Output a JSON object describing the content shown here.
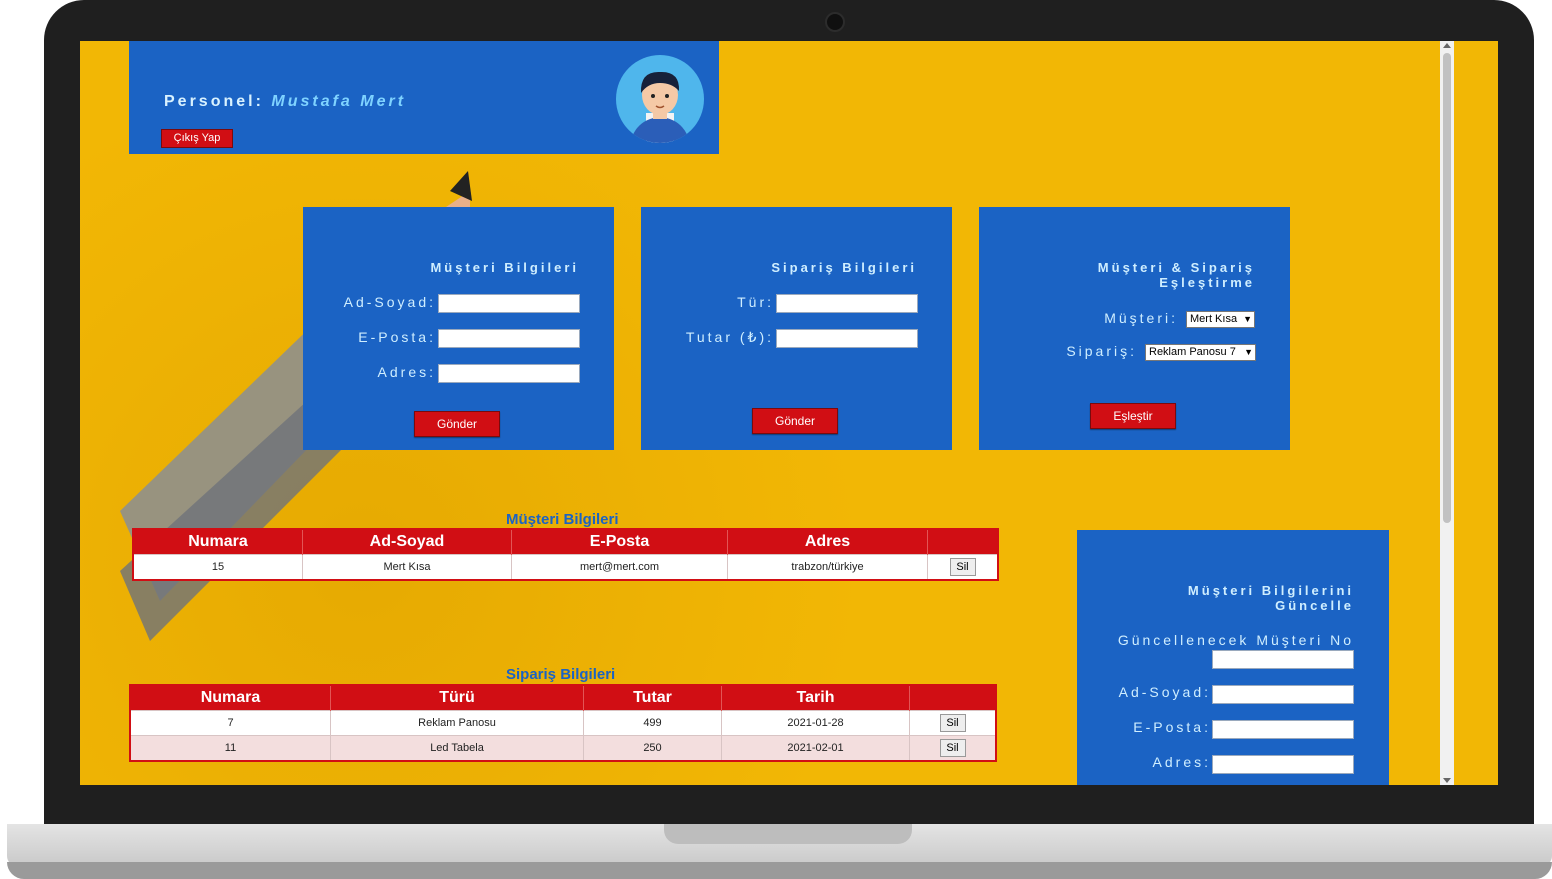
{
  "header": {
    "personel_label": "Personel:",
    "personel_name": "Mustafa Mert",
    "logout_label": "Çıkış Yap"
  },
  "customer_form": {
    "title": "Müşteri Bilgileri",
    "name_label": "Ad-Soyad:",
    "email_label": "E-Posta:",
    "address_label": "Adres:",
    "name_value": "",
    "email_value": "",
    "address_value": "",
    "submit_label": "Gönder"
  },
  "order_form": {
    "title": "Sipariş Bilgileri",
    "type_label": "Tür:",
    "amount_label": "Tutar (₺):",
    "type_value": "",
    "amount_value": "",
    "submit_label": "Gönder"
  },
  "match_form": {
    "title_line1": "Müşteri & Sipariş",
    "title_line2": "Eşleştirme",
    "customer_label": "Müşteri:",
    "customer_selected": "Mert Kısa",
    "order_label": "Sipariş:",
    "order_selected": "Reklam Panosu 7",
    "submit_label": "Eşleştir"
  },
  "customers_table": {
    "caption": "Müşteri Bilgileri",
    "headers": [
      "Numara",
      "Ad-Soyad",
      "E-Posta",
      "Adres",
      ""
    ],
    "rows": [
      {
        "no": "15",
        "name": "Mert Kısa",
        "email": "mert@mert.com",
        "address": "trabzon/türkiye",
        "action": "Sil"
      }
    ]
  },
  "orders_table": {
    "caption": "Sipariş Bilgileri",
    "headers": [
      "Numara",
      "Türü",
      "Tutar",
      "Tarih",
      ""
    ],
    "rows": [
      {
        "no": "7",
        "type": "Reklam Panosu",
        "amount": "499",
        "date": "2021-01-28",
        "action": "Sil"
      },
      {
        "no": "11",
        "type": "Led Tabela",
        "amount": "250",
        "date": "2021-02-01",
        "action": "Sil"
      }
    ]
  },
  "update_form": {
    "title_line1": "Müşteri Bilgilerini",
    "title_line2": "Güncelle",
    "id_label": "Güncellenecek Müşteri No",
    "name_label": "Ad-Soyad:",
    "email_label": "E-Posta:",
    "address_label": "Adres:"
  },
  "colors": {
    "panel_blue": "#1b63c4",
    "button_red": "#d10e14",
    "background_yellow": "#f2b705"
  }
}
